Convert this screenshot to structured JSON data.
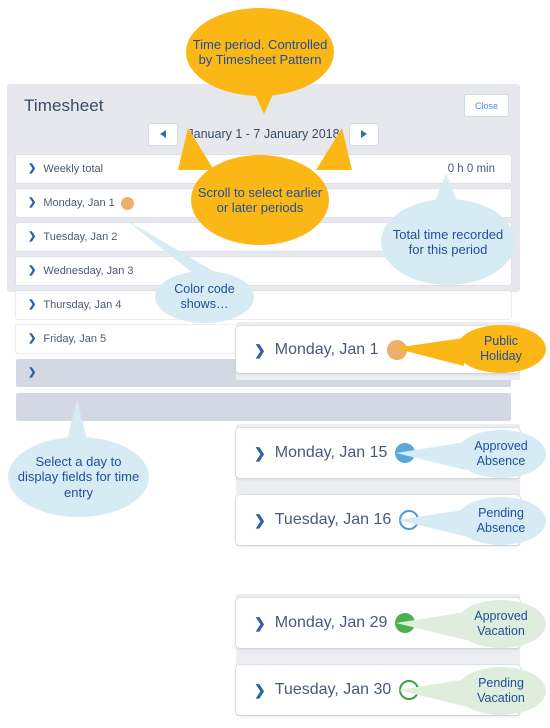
{
  "panel": {
    "title": "Timesheet",
    "close_label": "Close",
    "period_label": "January 1 - 7 January 2018",
    "prev_icon": "triangle-left-icon",
    "next_icon": "triangle-right-icon",
    "rows": [
      {
        "chevron": "❯",
        "label": "Weekly total",
        "total": "0 h 0 min",
        "dot": null,
        "weekend": false
      },
      {
        "chevron": "❯",
        "label": "Monday, Jan 1",
        "total": "",
        "dot": "orange",
        "weekend": false
      },
      {
        "chevron": "❯",
        "label": "Tuesday, Jan 2",
        "total": "",
        "dot": null,
        "weekend": false
      },
      {
        "chevron": "❯",
        "label": "Wednesday, Jan 3",
        "total": "",
        "dot": null,
        "weekend": false
      },
      {
        "chevron": "❯",
        "label": "Thursday, Jan 4",
        "total": "",
        "dot": null,
        "weekend": false
      },
      {
        "chevron": "❯",
        "label": "Friday, Jan 5",
        "total": "",
        "dot": null,
        "weekend": false
      },
      {
        "chevron": "❯",
        "label": "",
        "total": "",
        "dot": null,
        "weekend": true
      },
      {
        "chevron": "",
        "label": "",
        "total": "",
        "dot": null,
        "weekend": true
      }
    ]
  },
  "detail_cards": [
    {
      "chevron": "❯",
      "label": "Monday, Jan 1",
      "dot": "fill-orange"
    },
    {
      "chevron": "❯",
      "label": "Monday, Jan 15",
      "dot": "fill-blue"
    },
    {
      "chevron": "❯",
      "label": "Tuesday, Jan 16",
      "dot": "open-blue"
    },
    {
      "chevron": "❯",
      "label": "Monday, Jan 29",
      "dot": "fill-green"
    },
    {
      "chevron": "❯",
      "label": "Tuesday, Jan 30",
      "dot": "open-green"
    }
  ],
  "callouts": {
    "time_period": "Time period. Controlled by Timesheet Pattern",
    "scroll": "Scroll to select earlier or later periods",
    "total_time": "Total time recorded for this period",
    "color_code": "Color code shows…",
    "select_day": "Select a day to display fields for time entry",
    "public_holiday": "Public Holiday",
    "approved_absence": "Approved Absence",
    "pending_absence": "Pending Absence",
    "approved_vacation": "Approved Vacation",
    "pending_vacation": "Pending Vacation"
  },
  "colors": {
    "amber": "#fbb715",
    "ice": "#d6ebf4",
    "mint": "#deeddc",
    "orange_dot": "#eeae6e",
    "blue_dot": "#5aa7dd",
    "green_dot": "#4caf50",
    "panel_bg": "#e6e8ed",
    "text_blue": "#1f4e9c"
  }
}
